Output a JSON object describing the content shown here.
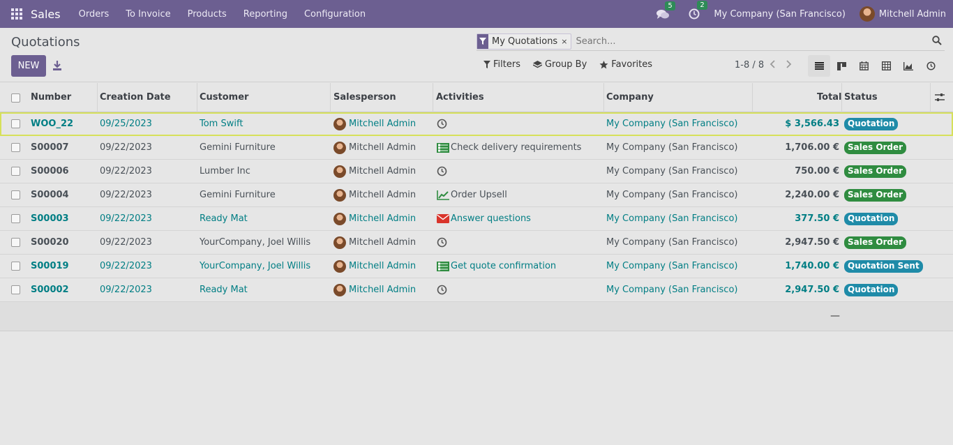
{
  "navbar": {
    "app_name": "Sales",
    "menu": [
      "Orders",
      "To Invoice",
      "Products",
      "Reporting",
      "Configuration"
    ],
    "messages_count": "5",
    "activities_count": "2",
    "company": "My Company (San Francisco)",
    "user": "Mitchell Admin",
    "bg_color": "#6c5f91"
  },
  "control": {
    "title": "Quotations",
    "new_label": "NEW",
    "facet_label": "My Quotations",
    "facet_close": "×",
    "search_placeholder": "Search...",
    "filters_label": "Filters",
    "group_by_label": "Group By",
    "favorites_label": "Favorites",
    "pager": "1-8 / 8"
  },
  "table": {
    "headers": [
      "Number",
      "Creation Date",
      "Customer",
      "Salesperson",
      "Activities",
      "Company",
      "Total",
      "Status"
    ],
    "rows": [
      {
        "number": "WOO_22",
        "date": "09/25/2023",
        "customer": "Tom Swift",
        "salesperson": "Mitchell Admin",
        "activity": "",
        "activity_icon": "clock-icon",
        "company": "My Company (San Francisco)",
        "total": "$ 3,566.43",
        "status": "Quotation"
      },
      {
        "number": "S00007",
        "date": "09/22/2023",
        "customer": "Gemini Furniture",
        "salesperson": "Mitchell Admin",
        "activity": "Check delivery requirements",
        "activity_icon": "tasks-icon",
        "company": "My Company (San Francisco)",
        "total": "1,706.00 €",
        "status": "Sales Order"
      },
      {
        "number": "S00006",
        "date": "09/22/2023",
        "customer": "Lumber Inc",
        "salesperson": "Mitchell Admin",
        "activity": "",
        "activity_icon": "clock-icon",
        "company": "My Company (San Francisco)",
        "total": "750.00 €",
        "status": "Sales Order"
      },
      {
        "number": "S00004",
        "date": "09/22/2023",
        "customer": "Gemini Furniture",
        "salesperson": "Mitchell Admin",
        "activity": "Order Upsell",
        "activity_icon": "chart-line-icon",
        "company": "My Company (San Francisco)",
        "total": "2,240.00 €",
        "status": "Sales Order"
      },
      {
        "number": "S00003",
        "date": "09/22/2023",
        "customer": "Ready Mat",
        "salesperson": "Mitchell Admin",
        "activity": "Answer questions",
        "activity_icon": "envelope-icon",
        "company": "My Company (San Francisco)",
        "total": "377.50 €",
        "status": "Quotation"
      },
      {
        "number": "S00020",
        "date": "09/22/2023",
        "customer": "YourCompany, Joel Willis",
        "salesperson": "Mitchell Admin",
        "activity": "",
        "activity_icon": "clock-icon",
        "company": "My Company (San Francisco)",
        "total": "2,947.50 €",
        "status": "Sales Order"
      },
      {
        "number": "S00019",
        "date": "09/22/2023",
        "customer": "YourCompany, Joel Willis",
        "salesperson": "Mitchell Admin",
        "activity": "Get quote confirmation",
        "activity_icon": "tasks-icon",
        "company": "My Company (San Francisco)",
        "total": "1,740.00 €",
        "status": "Quotation Sent"
      },
      {
        "number": "S00002",
        "date": "09/22/2023",
        "customer": "Ready Mat",
        "salesperson": "Mitchell Admin",
        "activity": "",
        "activity_icon": "clock-icon",
        "company": "My Company (San Francisco)",
        "total": "2,947.50 €",
        "status": "Quotation"
      }
    ],
    "footer_total": "—"
  }
}
